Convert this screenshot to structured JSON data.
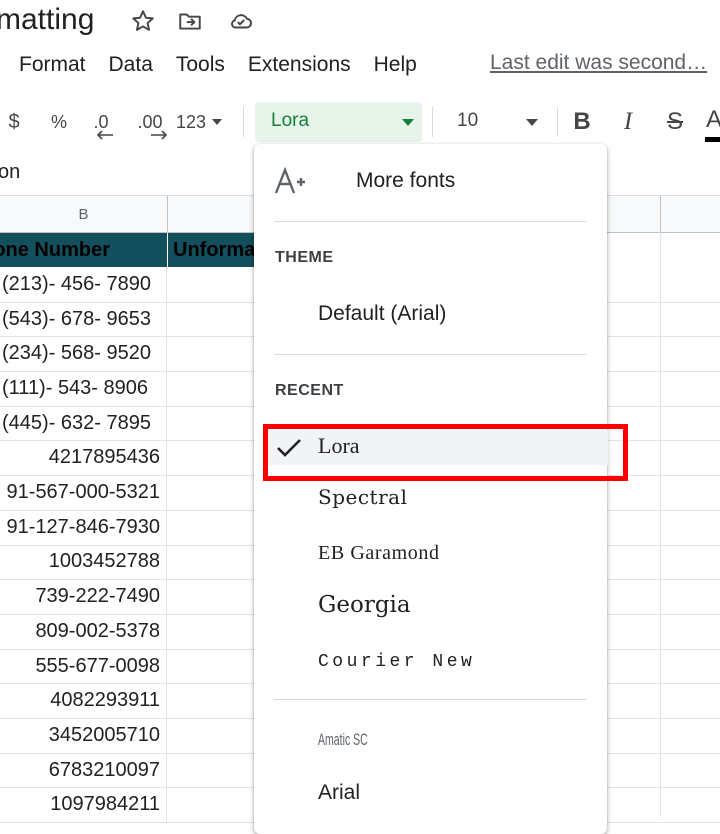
{
  "title": {
    "text": "matting"
  },
  "menu": {
    "items": [
      "Format",
      "Data",
      "Tools",
      "Extensions",
      "Help"
    ],
    "last_edit": "Last edit was second…"
  },
  "toolbar": {
    "currency": "$",
    "percent": "%",
    "decrease_decimal": ".0",
    "increase_decimal": ".00",
    "more_formats": "123",
    "font": "Lora",
    "font_size": "10",
    "bold": "B",
    "italic": "I",
    "strikethrough": "S",
    "text_color": "A"
  },
  "formula": {
    "text": "on"
  },
  "grid": {
    "col_b_header": "B",
    "header_b": "one Number",
    "header_c": "Unforma",
    "rows": [
      "(213)- 456- 7890",
      "(543)- 678- 9653",
      "(234)- 568- 9520",
      "(111)- 543- 8906",
      "(445)- 632- 7895",
      "4217895436",
      "91-567-000-5321",
      "91-127-846-7930",
      "1003452788",
      "739-222-7490",
      "809-002-5378",
      "555-677-0098",
      "4082293911",
      "3452005710",
      "6783210097",
      "1097984211"
    ]
  },
  "dropdown": {
    "more_fonts": "More fonts",
    "theme_label": "THEME",
    "theme_font": "Default (Arial)",
    "recent_label": "RECENT",
    "recent": [
      "Lora",
      "Spectral",
      "EB Garamond",
      "Georgia",
      "Courier New"
    ],
    "selected": "Lora",
    "other": [
      "Amatic SC",
      "Arial"
    ]
  },
  "colors": {
    "font_select_bg": "#e6f4ea",
    "font_select_text": "#188038",
    "header_fill": "#134f5c",
    "highlight": "#ff0000"
  }
}
